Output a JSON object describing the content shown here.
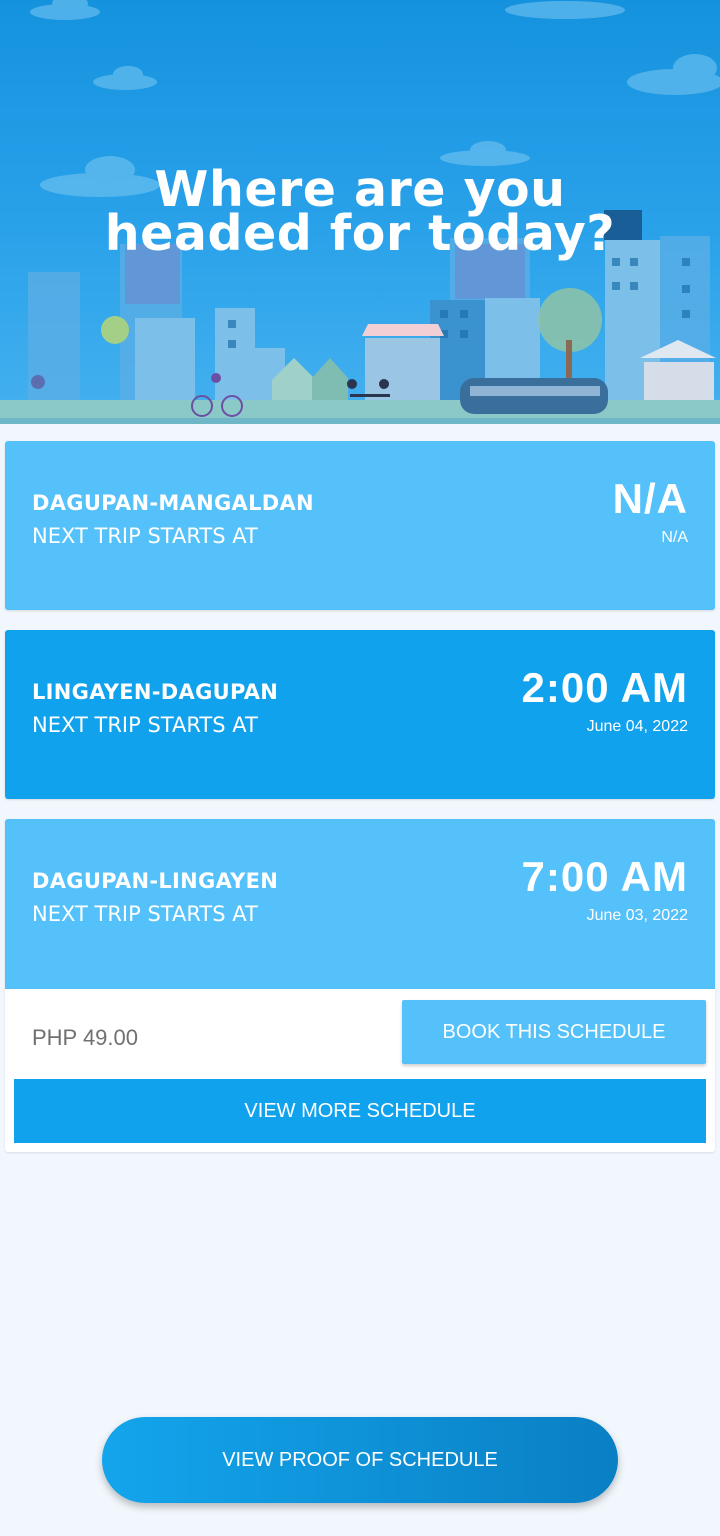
{
  "hero": {
    "title_line1": "Where are you",
    "title_line2": "headed for today?"
  },
  "schedules": [
    {
      "route": "DAGUPAN-MANGALDAN",
      "subtitle": "NEXT TRIP STARTS AT",
      "time": "N/A",
      "date": "N/A"
    },
    {
      "route": "LINGAYEN-DAGUPAN",
      "subtitle": "NEXT TRIP STARTS AT",
      "time": "2:00 AM",
      "date": "June 04, 2022"
    },
    {
      "route": "DAGUPAN-LINGAYEN",
      "subtitle": "NEXT TRIP STARTS AT",
      "time": "7:00 AM",
      "date": "June 03, 2022"
    }
  ],
  "expanded": {
    "price": "PHP 49.00",
    "book_label": "BOOK THIS SCHEDULE",
    "more_label": "VIEW MORE SCHEDULE"
  },
  "footer": {
    "proof_label": "VIEW PROOF OF SCHEDULE"
  },
  "colors": {
    "card_light": "#55c1fb",
    "card_dark": "#11a2ee",
    "background": "#f1f7fc"
  }
}
